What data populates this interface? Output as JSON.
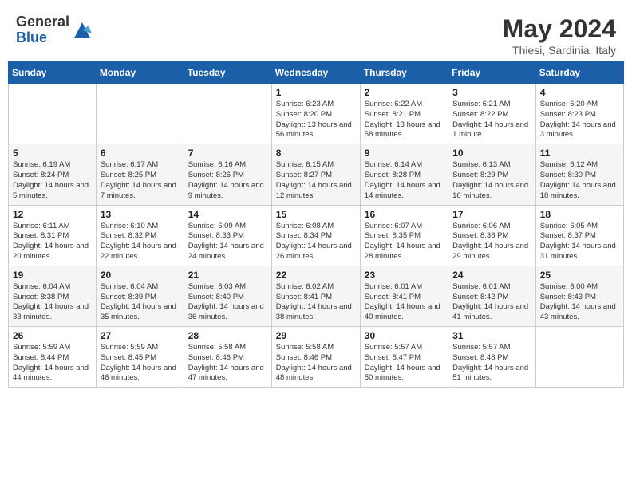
{
  "header": {
    "logo": {
      "general": "General",
      "blue": "Blue"
    },
    "title": "May 2024",
    "location": "Thiesi, Sardinia, Italy"
  },
  "calendar": {
    "days_of_week": [
      "Sunday",
      "Monday",
      "Tuesday",
      "Wednesday",
      "Thursday",
      "Friday",
      "Saturday"
    ],
    "weeks": [
      [
        {
          "day": "",
          "info": ""
        },
        {
          "day": "",
          "info": ""
        },
        {
          "day": "",
          "info": ""
        },
        {
          "day": "1",
          "info": "Sunrise: 6:23 AM\nSunset: 8:20 PM\nDaylight: 13 hours and 56 minutes."
        },
        {
          "day": "2",
          "info": "Sunrise: 6:22 AM\nSunset: 8:21 PM\nDaylight: 13 hours and 58 minutes."
        },
        {
          "day": "3",
          "info": "Sunrise: 6:21 AM\nSunset: 8:22 PM\nDaylight: 14 hours and 1 minute."
        },
        {
          "day": "4",
          "info": "Sunrise: 6:20 AM\nSunset: 8:23 PM\nDaylight: 14 hours and 3 minutes."
        }
      ],
      [
        {
          "day": "5",
          "info": "Sunrise: 6:19 AM\nSunset: 8:24 PM\nDaylight: 14 hours and 5 minutes."
        },
        {
          "day": "6",
          "info": "Sunrise: 6:17 AM\nSunset: 8:25 PM\nDaylight: 14 hours and 7 minutes."
        },
        {
          "day": "7",
          "info": "Sunrise: 6:16 AM\nSunset: 8:26 PM\nDaylight: 14 hours and 9 minutes."
        },
        {
          "day": "8",
          "info": "Sunrise: 6:15 AM\nSunset: 8:27 PM\nDaylight: 14 hours and 12 minutes."
        },
        {
          "day": "9",
          "info": "Sunrise: 6:14 AM\nSunset: 8:28 PM\nDaylight: 14 hours and 14 minutes."
        },
        {
          "day": "10",
          "info": "Sunrise: 6:13 AM\nSunset: 8:29 PM\nDaylight: 14 hours and 16 minutes."
        },
        {
          "day": "11",
          "info": "Sunrise: 6:12 AM\nSunset: 8:30 PM\nDaylight: 14 hours and 18 minutes."
        }
      ],
      [
        {
          "day": "12",
          "info": "Sunrise: 6:11 AM\nSunset: 8:31 PM\nDaylight: 14 hours and 20 minutes."
        },
        {
          "day": "13",
          "info": "Sunrise: 6:10 AM\nSunset: 8:32 PM\nDaylight: 14 hours and 22 minutes."
        },
        {
          "day": "14",
          "info": "Sunrise: 6:09 AM\nSunset: 8:33 PM\nDaylight: 14 hours and 24 minutes."
        },
        {
          "day": "15",
          "info": "Sunrise: 6:08 AM\nSunset: 8:34 PM\nDaylight: 14 hours and 26 minutes."
        },
        {
          "day": "16",
          "info": "Sunrise: 6:07 AM\nSunset: 8:35 PM\nDaylight: 14 hours and 28 minutes."
        },
        {
          "day": "17",
          "info": "Sunrise: 6:06 AM\nSunset: 8:36 PM\nDaylight: 14 hours and 29 minutes."
        },
        {
          "day": "18",
          "info": "Sunrise: 6:05 AM\nSunset: 8:37 PM\nDaylight: 14 hours and 31 minutes."
        }
      ],
      [
        {
          "day": "19",
          "info": "Sunrise: 6:04 AM\nSunset: 8:38 PM\nDaylight: 14 hours and 33 minutes."
        },
        {
          "day": "20",
          "info": "Sunrise: 6:04 AM\nSunset: 8:39 PM\nDaylight: 14 hours and 35 minutes."
        },
        {
          "day": "21",
          "info": "Sunrise: 6:03 AM\nSunset: 8:40 PM\nDaylight: 14 hours and 36 minutes."
        },
        {
          "day": "22",
          "info": "Sunrise: 6:02 AM\nSunset: 8:41 PM\nDaylight: 14 hours and 38 minutes."
        },
        {
          "day": "23",
          "info": "Sunrise: 6:01 AM\nSunset: 8:41 PM\nDaylight: 14 hours and 40 minutes."
        },
        {
          "day": "24",
          "info": "Sunrise: 6:01 AM\nSunset: 8:42 PM\nDaylight: 14 hours and 41 minutes."
        },
        {
          "day": "25",
          "info": "Sunrise: 6:00 AM\nSunset: 8:43 PM\nDaylight: 14 hours and 43 minutes."
        }
      ],
      [
        {
          "day": "26",
          "info": "Sunrise: 5:59 AM\nSunset: 8:44 PM\nDaylight: 14 hours and 44 minutes."
        },
        {
          "day": "27",
          "info": "Sunrise: 5:59 AM\nSunset: 8:45 PM\nDaylight: 14 hours and 46 minutes."
        },
        {
          "day": "28",
          "info": "Sunrise: 5:58 AM\nSunset: 8:46 PM\nDaylight: 14 hours and 47 minutes."
        },
        {
          "day": "29",
          "info": "Sunrise: 5:58 AM\nSunset: 8:46 PM\nDaylight: 14 hours and 48 minutes."
        },
        {
          "day": "30",
          "info": "Sunrise: 5:57 AM\nSunset: 8:47 PM\nDaylight: 14 hours and 50 minutes."
        },
        {
          "day": "31",
          "info": "Sunrise: 5:57 AM\nSunset: 8:48 PM\nDaylight: 14 hours and 51 minutes."
        },
        {
          "day": "",
          "info": ""
        }
      ]
    ]
  }
}
